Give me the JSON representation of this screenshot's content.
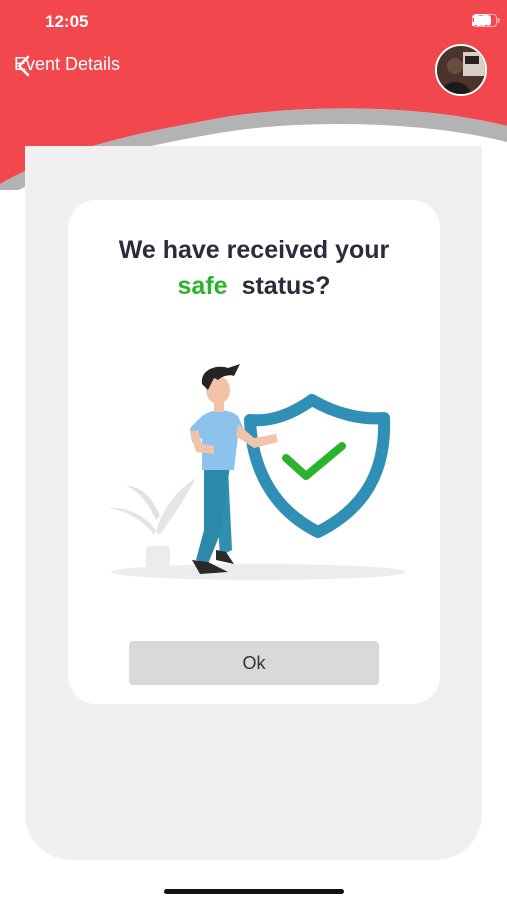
{
  "status_bar": {
    "time": "12:05",
    "icons": [
      "signal-icon",
      "wifi-icon",
      "battery-icon"
    ]
  },
  "nav": {
    "back_icon": "chevron-left-icon",
    "title": "Event Details",
    "avatar": "avatar"
  },
  "card": {
    "question_line1": "We have received your",
    "highlight_word": "safe",
    "question_rest": "status?",
    "ok_label": "Ok"
  },
  "colors": {
    "header": "#f2484d",
    "accent_safe": "#2bb42b",
    "shield": "#2f8fb5",
    "check": "#2bb42b",
    "panel": "#f0f0f0",
    "button": "#d9d9d9"
  }
}
